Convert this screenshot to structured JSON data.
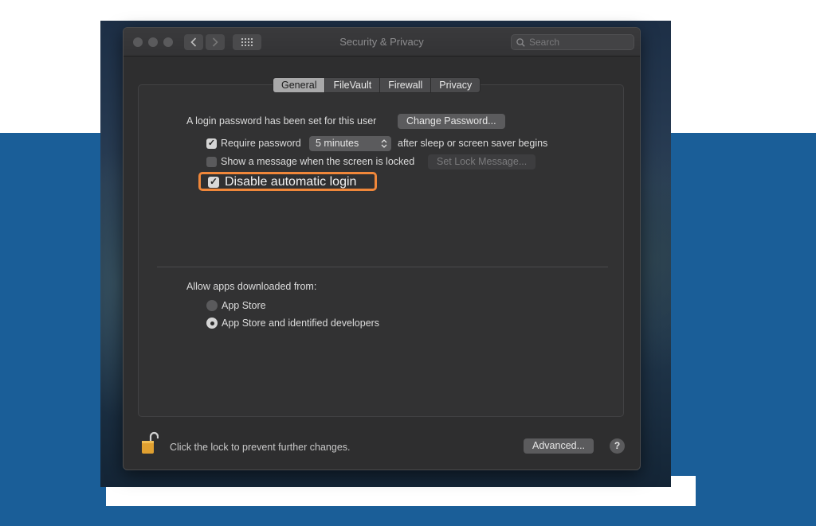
{
  "window": {
    "title": "Security & Privacy",
    "search_placeholder": "Search"
  },
  "tabs": [
    {
      "label": "General",
      "active": true
    },
    {
      "label": "FileVault",
      "active": false
    },
    {
      "label": "Firewall",
      "active": false
    },
    {
      "label": "Privacy",
      "active": false
    }
  ],
  "general": {
    "login_password_text": "A login password has been set for this user",
    "change_password_label": "Change Password...",
    "require_password_label": "Require password",
    "require_password_checked": true,
    "require_password_delay": "5 minutes",
    "require_password_suffix": "after sleep or screen saver begins",
    "show_message_label": "Show a message when the screen is locked",
    "show_message_checked": false,
    "set_lock_message_label": "Set Lock Message...",
    "disable_auto_login_label": "Disable automatic login",
    "disable_auto_login_checked": true,
    "allow_apps_label": "Allow apps downloaded from:",
    "app_sources": [
      {
        "label": "App Store",
        "selected": false
      },
      {
        "label": "App Store and identified developers",
        "selected": true
      }
    ]
  },
  "footer": {
    "lock_text": "Click the lock to prevent further changes.",
    "advanced_label": "Advanced...",
    "help_label": "?"
  },
  "colors": {
    "highlight": "#f0873a",
    "background_blue": "#1a5e98",
    "lock_gold": "#e0a030"
  }
}
